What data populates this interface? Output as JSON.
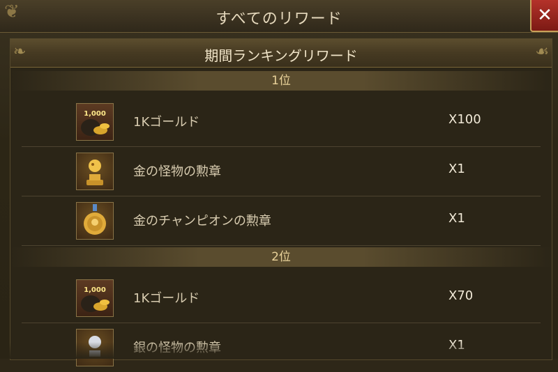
{
  "window": {
    "title": "すべてのリワード",
    "close_label": "✕"
  },
  "panel": {
    "title": "期間ランキングリワード"
  },
  "ranks": [
    {
      "label": "1位",
      "items": [
        {
          "name": "1Kゴールド",
          "qty": "X100",
          "icon": "gold-coins-icon",
          "icon_text": "1,000"
        },
        {
          "name": "金の怪物の勲章",
          "qty": "X1",
          "icon": "gold-monster-medal-icon"
        },
        {
          "name": "金のチャンピオンの勲章",
          "qty": "X1",
          "icon": "gold-champion-medal-icon"
        }
      ]
    },
    {
      "label": "2位",
      "items": [
        {
          "name": "1Kゴールド",
          "qty": "X70",
          "icon": "gold-coins-icon",
          "icon_text": "1,000"
        },
        {
          "name": "銀の怪物の勲章",
          "qty": "X1",
          "icon": "silver-monster-medal-icon"
        }
      ]
    }
  ],
  "colors": {
    "accent_gold": "#e9d29a",
    "close_red": "#b4322a"
  }
}
